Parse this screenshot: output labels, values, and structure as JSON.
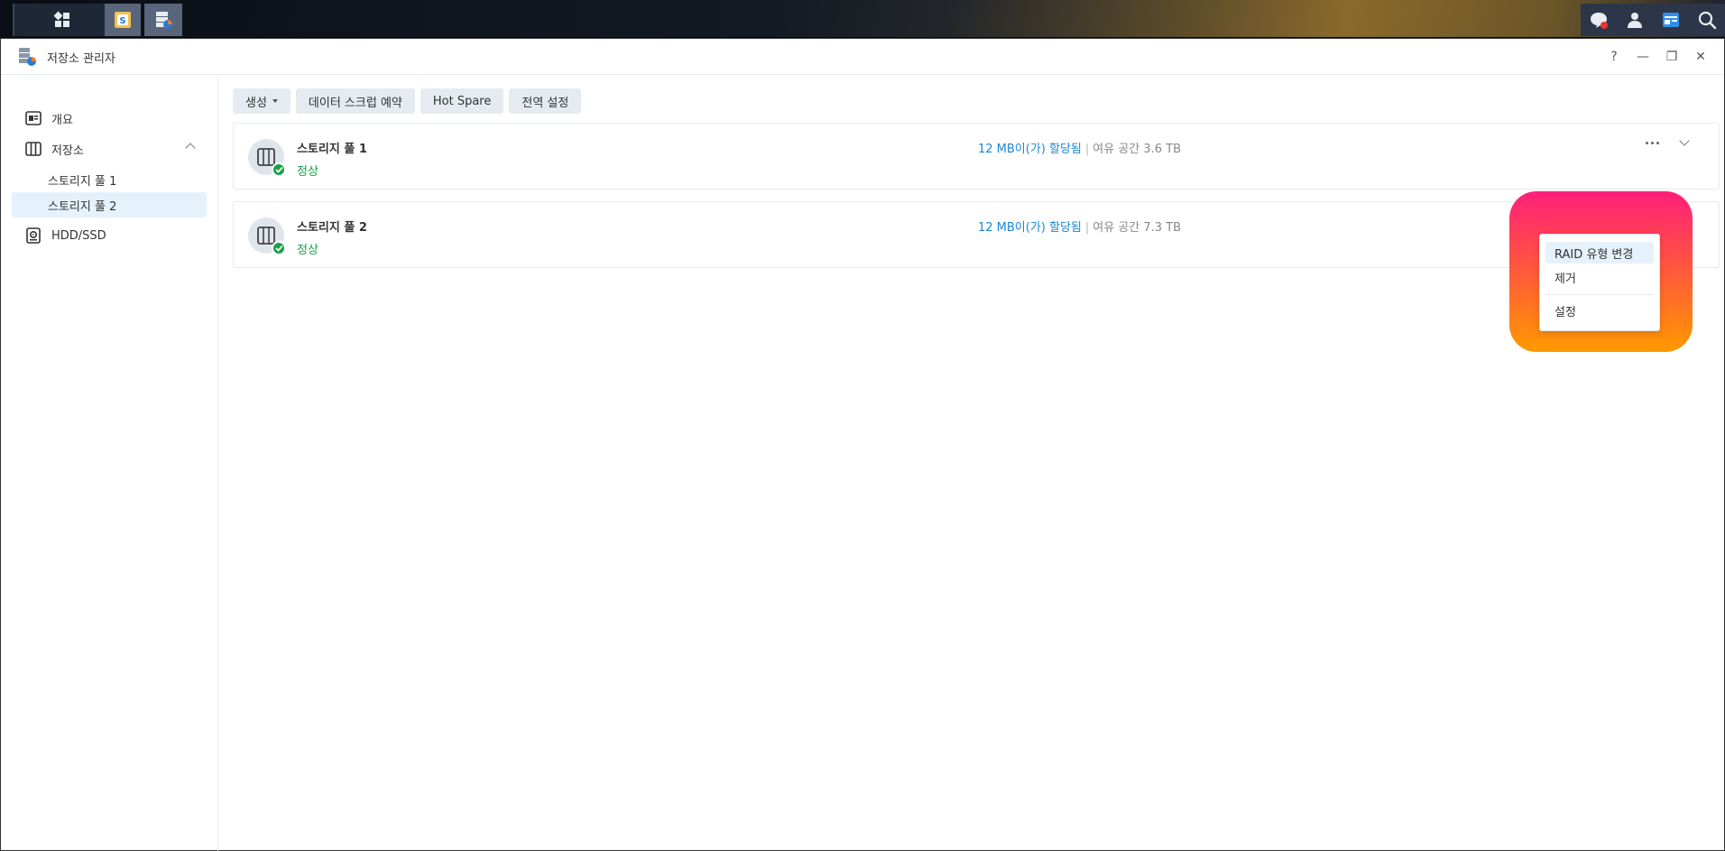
{
  "taskbar": {
    "left_icons": [
      "apps-grid-icon",
      "synology-app-icon",
      "storage-manager-taskbar-icon"
    ],
    "right_icons": [
      "chat-notification-icon",
      "user-icon",
      "widgets-icon",
      "search-icon"
    ]
  },
  "window": {
    "title": "저장소 관리자",
    "controls": {
      "help": "?",
      "minimize": "—",
      "restore": "❐",
      "close": "✕"
    }
  },
  "sidebar": {
    "items": [
      {
        "label": "개요",
        "icon": "overview-icon"
      },
      {
        "label": "저장소",
        "icon": "storage-icon",
        "expanded": true
      },
      {
        "label": "HDD/SSD",
        "icon": "hdd-icon"
      }
    ],
    "sub_items": [
      {
        "label": "스토리지 풀 1"
      },
      {
        "label": "스토리지 풀 2",
        "selected": true
      }
    ]
  },
  "toolbar": {
    "create_label": "생성",
    "scrub_label": "데이터 스크럽 예약",
    "hot_spare_label": "Hot Spare",
    "global_settings_label": "전역 설정"
  },
  "pools": [
    {
      "name": "스토리지 풀 1",
      "status": "정상",
      "allocated": "12 MB이(가) 할당됨",
      "separator": "|",
      "free": "여유 공간 3.6 TB"
    },
    {
      "name": "스토리지 풀 2",
      "status": "정상",
      "allocated": "12 MB이(가) 할당됨",
      "separator": "|",
      "free": "여유 공간 7.3 TB"
    }
  ],
  "context_menu": {
    "items": [
      "RAID 유형 변경",
      "제거",
      "설정"
    ]
  },
  "colors": {
    "accent_blue": "#1a87d4",
    "status_green": "#1aa04a",
    "highlight_start": "#ff1f7a",
    "highlight_end": "#ff9900"
  }
}
